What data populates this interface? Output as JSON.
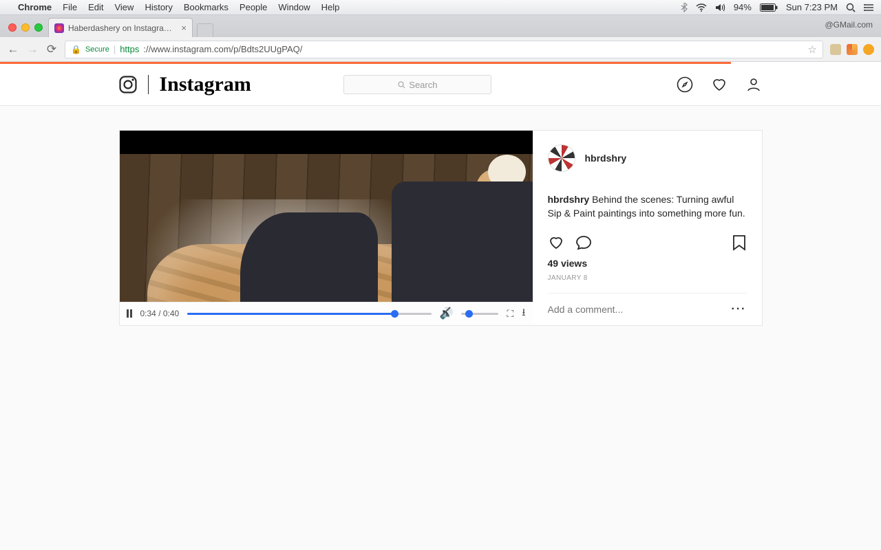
{
  "menubar": {
    "app": "Chrome",
    "items": [
      "File",
      "Edit",
      "View",
      "History",
      "Bookmarks",
      "People",
      "Window",
      "Help"
    ],
    "battery_pct": "94%",
    "clock": "Sun 7:23 PM"
  },
  "browser": {
    "tab_title": "Haberdashery on Instagram: \"",
    "right_info": "@GMail.com",
    "secure_label": "Secure",
    "url_proto": "https",
    "url_rest": "://www.instagram.com/p/Bdts2UUgPAQ/"
  },
  "ig": {
    "wordmark": "Instagram",
    "search_placeholder": "Search"
  },
  "post": {
    "username": "hbrdshry",
    "caption_user": "hbrdshry",
    "caption_text": "Behind the scenes: Turning awful Sip & Paint paintings into something more fun.",
    "views": "49 views",
    "date": "JANUARY 8",
    "comment_placeholder": "Add a comment..."
  },
  "video": {
    "time": "0:34 / 0:40",
    "progress_pct": 85
  }
}
